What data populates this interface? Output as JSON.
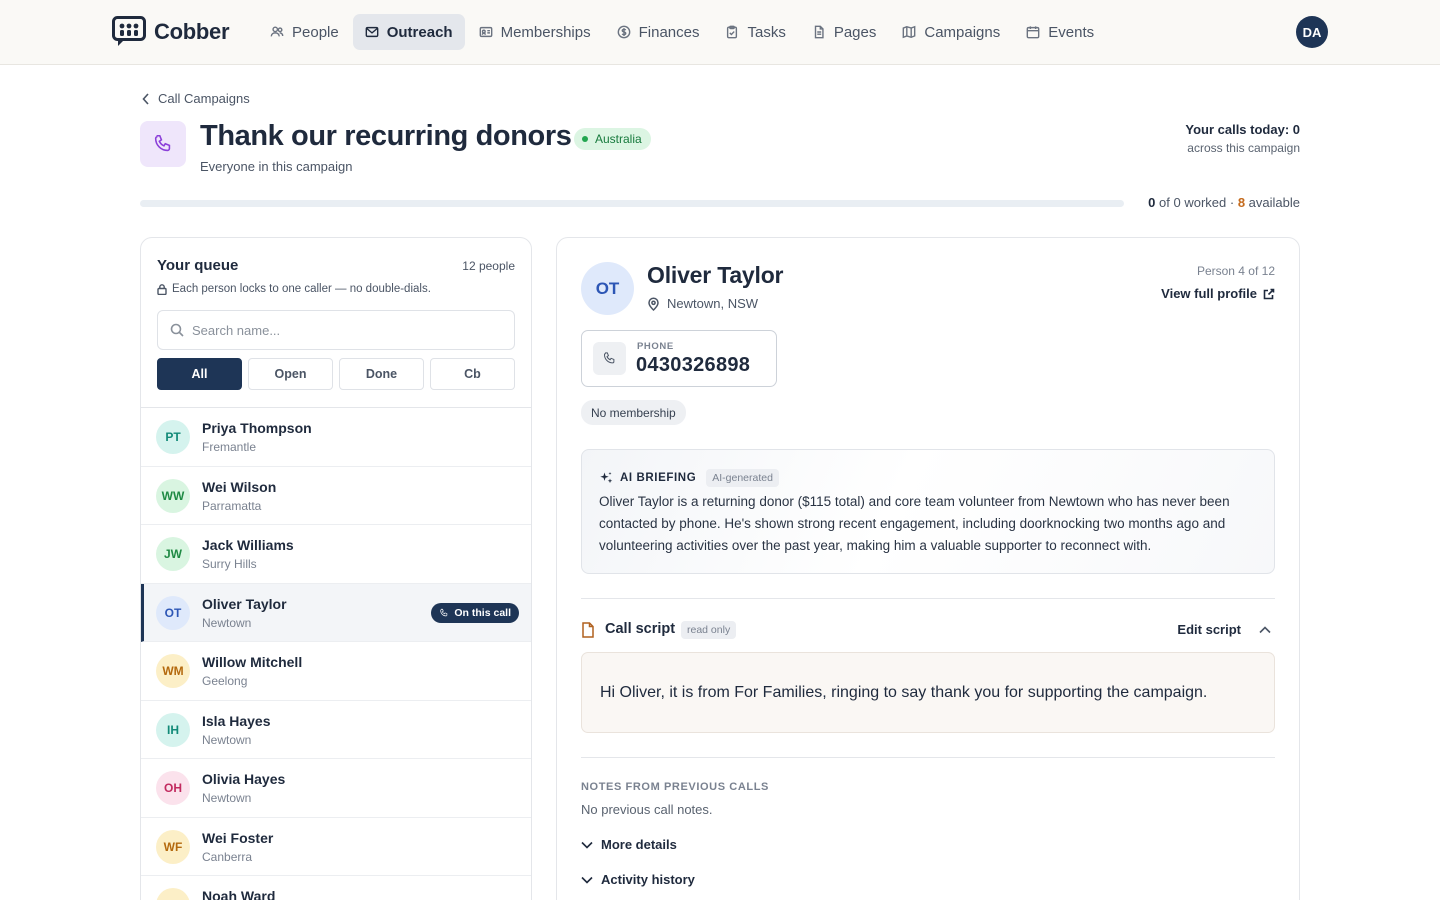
{
  "app": {
    "name": "Cobber",
    "user_initials": "DA"
  },
  "nav": [
    {
      "label": "People",
      "icon": "people-icon",
      "active": false
    },
    {
      "label": "Outreach",
      "icon": "mail-icon",
      "active": true
    },
    {
      "label": "Memberships",
      "icon": "id-card-icon",
      "active": false
    },
    {
      "label": "Finances",
      "icon": "dollar-icon",
      "active": false
    },
    {
      "label": "Tasks",
      "icon": "clipboard-icon",
      "active": false
    },
    {
      "label": "Pages",
      "icon": "file-icon",
      "active": false
    },
    {
      "label": "Campaigns",
      "icon": "map-icon",
      "active": false
    },
    {
      "label": "Events",
      "icon": "calendar-icon",
      "active": false
    }
  ],
  "header": {
    "breadcrumb": "Call Campaigns",
    "title": "Thank our recurring donors",
    "region": "Australia",
    "subtitle": "Everyone in this campaign",
    "calls_today": "Your calls today: 0",
    "calls_scope": "across this campaign"
  },
  "progress": {
    "worked": "0",
    "of_text": "of 0 worked ·",
    "available": "8",
    "available_label": "available",
    "fraction": 0
  },
  "queue": {
    "title": "Your queue",
    "count": "12 people",
    "lock_note": "Each person locks to one caller — no double-dials.",
    "search_placeholder": "Search name...",
    "filters": [
      "All",
      "Open",
      "Done",
      "Cb"
    ],
    "active_filter": 0,
    "on_call_label": "On this call",
    "people": [
      {
        "initials": "PT",
        "name": "Priya Thompson",
        "location": "Fremantle",
        "bg": "#d5f3ee",
        "fg": "#128a78",
        "active": false
      },
      {
        "initials": "WW",
        "name": "Wei Wilson",
        "location": "Parramatta",
        "bg": "#d9f5e1",
        "fg": "#1f8a44",
        "active": false
      },
      {
        "initials": "JW",
        "name": "Jack Williams",
        "location": "Surry Hills",
        "bg": "#d9f5e1",
        "fg": "#1f8a44",
        "active": false
      },
      {
        "initials": "OT",
        "name": "Oliver Taylor",
        "location": "Newtown",
        "bg": "#dfe9fb",
        "fg": "#2d56b5",
        "active": true
      },
      {
        "initials": "WM",
        "name": "Willow Mitchell",
        "location": "Geelong",
        "bg": "#fcefc7",
        "fg": "#b4690e",
        "active": false
      },
      {
        "initials": "IH",
        "name": "Isla Hayes",
        "location": "Newtown",
        "bg": "#d5f3ee",
        "fg": "#128a78",
        "active": false
      },
      {
        "initials": "OH",
        "name": "Olivia Hayes",
        "location": "Newtown",
        "bg": "#fbe2ec",
        "fg": "#c22a5f",
        "active": false
      },
      {
        "initials": "WF",
        "name": "Wei Foster",
        "location": "Canberra",
        "bg": "#fcefc7",
        "fg": "#b4690e",
        "active": false
      },
      {
        "initials": "NW",
        "name": "Noah Ward",
        "location": "",
        "bg": "#fcefc7",
        "fg": "#b4690e",
        "active": false
      }
    ]
  },
  "detail": {
    "initials": "OT",
    "name": "Oliver Taylor",
    "location": "Newtown, NSW",
    "position": "Person 4 of 12",
    "profile_link": "View full profile",
    "phone_label": "PHONE",
    "phone": "0430326898",
    "membership": "No membership",
    "ai_title": "AI BRIEFING",
    "ai_tag": "AI-generated",
    "ai_text": "Oliver Taylor is a returning donor ($115 total) and core team volunteer from Newtown who has never been contacted by phone. He's shown strong recent engagement, including doorknocking two months ago and volunteering activities over the past year, making him a valuable supporter to reconnect with.",
    "script_title": "Call script",
    "script_tag": "read only",
    "edit_script": "Edit script",
    "script_text": "Hi Oliver, it is from For Families, ringing to say thank you for supporting the campaign.",
    "notes_label": "NOTES FROM PREVIOUS CALLS",
    "notes_empty": "No previous call notes.",
    "more_details": "More details",
    "activity_history": "Activity history"
  }
}
